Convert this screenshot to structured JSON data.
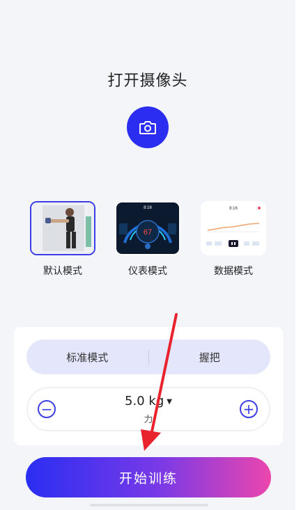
{
  "header": {
    "title": "打开摄像头"
  },
  "camera": {
    "icon": "camera-icon",
    "color": "#2b2ef0"
  },
  "modes": [
    {
      "label": "默认模式",
      "selected": true
    },
    {
      "label": "仪表模式",
      "selected": false,
      "preview": {
        "time": "8:16",
        "value": "67"
      }
    },
    {
      "label": "数据模式",
      "selected": false,
      "preview": {
        "time": "8:16"
      }
    }
  ],
  "settings": {
    "segment": [
      {
        "label": "标准模式"
      },
      {
        "label": "握把"
      }
    ],
    "stepper": {
      "value": "5.0 kg",
      "sublabel": "力"
    }
  },
  "start_button": {
    "label": "开始训练"
  },
  "colors": {
    "accent": "#3b3fe3",
    "gradient_start": "#2a2ef3",
    "gradient_end": "#ec46ad",
    "arrow": "#e8232e"
  }
}
